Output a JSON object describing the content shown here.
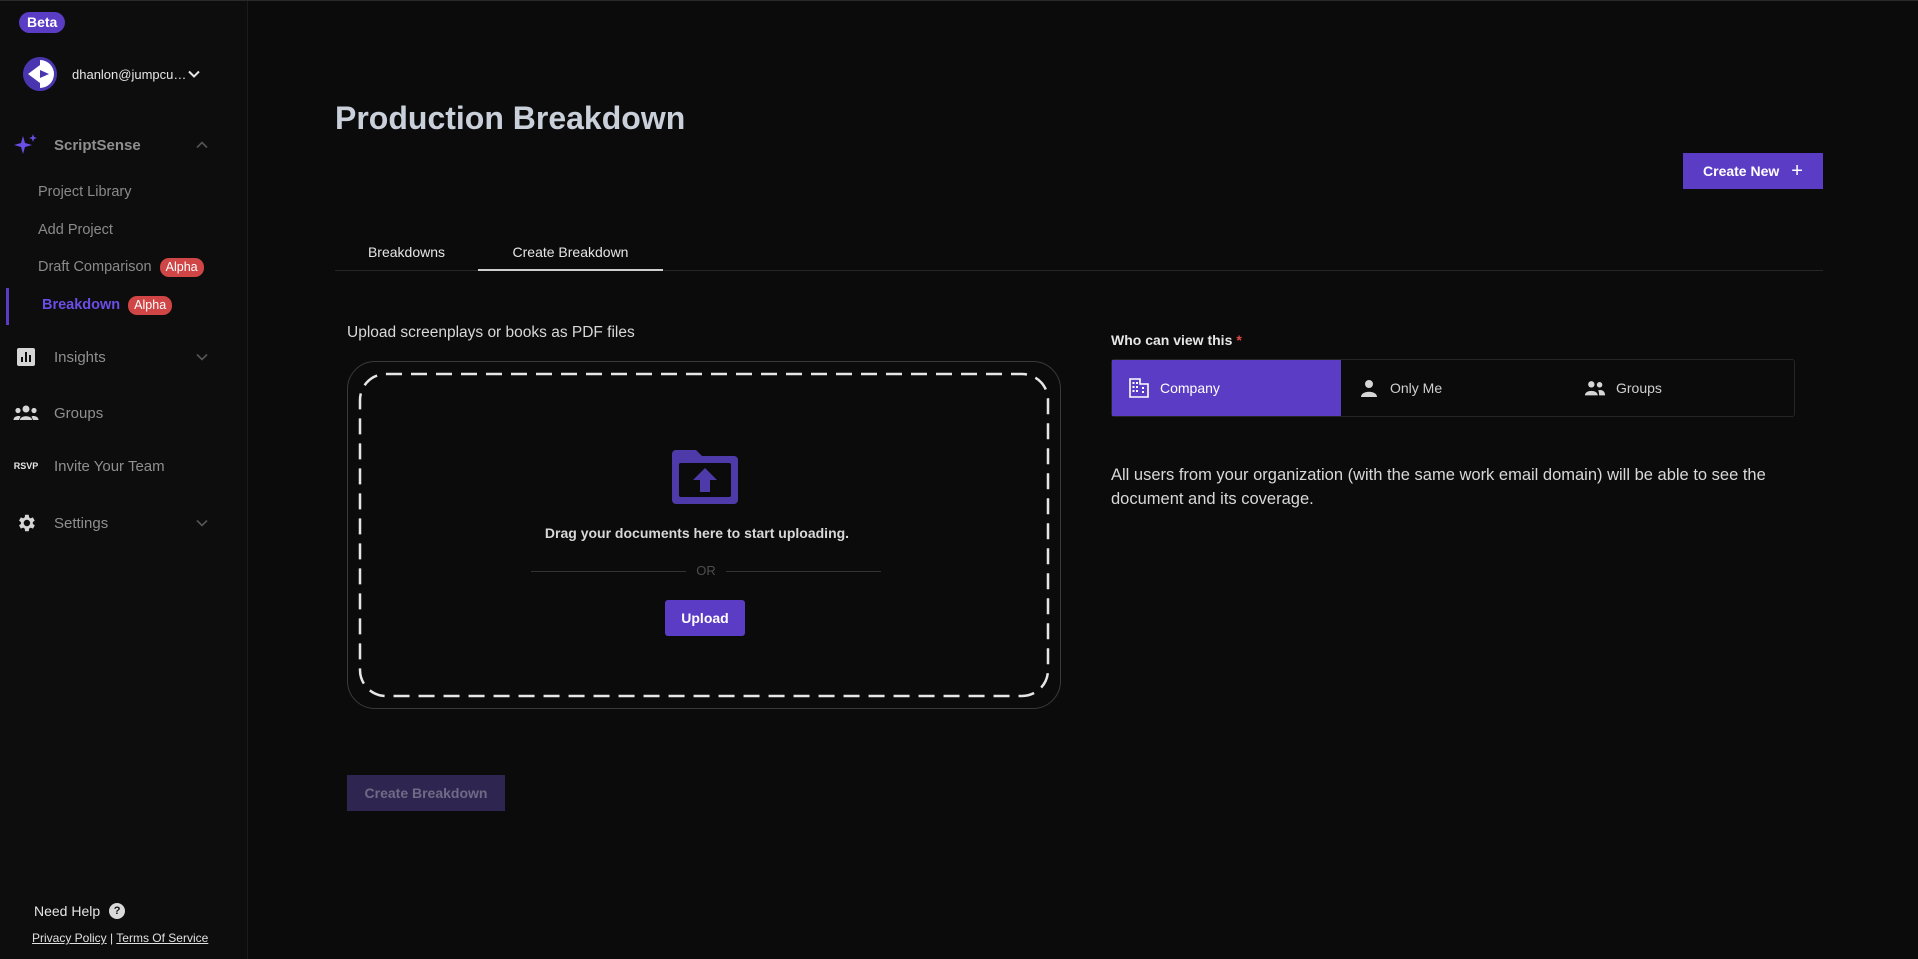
{
  "sidebar": {
    "badge": "Beta",
    "account": {
      "email": "dhanlon@jumpcut..."
    },
    "scriptsense": {
      "label": "ScriptSense",
      "items": [
        {
          "label": "Project Library"
        },
        {
          "label": "Add Project"
        },
        {
          "label": "Draft Comparison",
          "badge": "Alpha"
        },
        {
          "label": "Breakdown",
          "badge": "Alpha",
          "active": true
        }
      ]
    },
    "insights": {
      "label": "Insights"
    },
    "groups": {
      "label": "Groups"
    },
    "invite": {
      "label": "Invite Your Team",
      "icon_text": "RSVP"
    },
    "settings": {
      "label": "Settings"
    },
    "help": {
      "label": "Need Help"
    },
    "legal": {
      "privacy": "Privacy Policy",
      "separator": "|",
      "terms": "Terms Of Service"
    }
  },
  "main": {
    "title": "Production Breakdown",
    "create_new": "Create New",
    "tabs": [
      {
        "label": "Breakdowns"
      },
      {
        "label": "Create Breakdown",
        "active": true
      }
    ],
    "upload": {
      "label": "Upload screenplays or books as PDF files",
      "drag_text": "Drag your documents here to start uploading.",
      "or_text": "OR",
      "button": "Upload"
    },
    "visibility": {
      "label": "Who can view this",
      "required_mark": "*",
      "options": [
        {
          "label": "Company",
          "icon": "building-icon",
          "selected": true
        },
        {
          "label": "Only Me",
          "icon": "person-icon"
        },
        {
          "label": "Groups",
          "icon": "people-icon"
        }
      ],
      "description": "All users from your organization (with the same work email domain) will be able to see the document and its coverage."
    },
    "submit": "Create Breakdown"
  },
  "colors": {
    "accent": "#5b3cc4",
    "alpha_badge": "#d04545",
    "background": "#0b0b0b"
  }
}
